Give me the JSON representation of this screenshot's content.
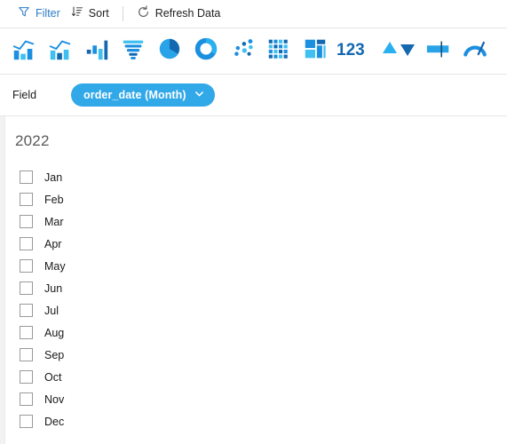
{
  "commandbar": {
    "items": [
      {
        "id": "filter",
        "label": "Filter",
        "icon": "funnel-icon",
        "style": "accent"
      },
      {
        "id": "sort",
        "label": "Sort",
        "icon": "sort-icon",
        "style": "dark"
      },
      {
        "id": "refresh",
        "label": "Refresh Data",
        "icon": "refresh-icon",
        "style": "dark"
      }
    ]
  },
  "viz_toolbar": {
    "items": [
      {
        "id": "line-column-combo",
        "icon": "line-column-chart-icon"
      },
      {
        "id": "line-column-combo2",
        "icon": "line-column-chart-alt-icon"
      },
      {
        "id": "column-chart",
        "icon": "column-chart-icon"
      },
      {
        "id": "funnel-chart",
        "icon": "funnel-chart-icon"
      },
      {
        "id": "pie-chart",
        "icon": "pie-chart-icon"
      },
      {
        "id": "donut-chart",
        "icon": "donut-chart-icon"
      },
      {
        "id": "scatter-chart",
        "icon": "scatter-chart-icon"
      },
      {
        "id": "heatmap-chart",
        "icon": "heatmap-grid-icon"
      },
      {
        "id": "treemap-chart",
        "icon": "treemap-icon"
      },
      {
        "id": "number-card",
        "icon": "number-123-icon"
      },
      {
        "id": "kpi-comparison",
        "icon": "up-down-triangles-icon"
      },
      {
        "id": "bullet-chart",
        "icon": "bullet-bar-icon"
      },
      {
        "id": "gauge-chart",
        "icon": "gauge-icon"
      }
    ]
  },
  "field_row": {
    "label": "Field",
    "selected_field": "order_date (Month)",
    "chevron": "chevron-down-icon",
    "pill_color": "#31a8e8"
  },
  "filter_list": {
    "group_title": "2022",
    "options": [
      {
        "label": "Jan",
        "checked": false
      },
      {
        "label": "Feb",
        "checked": false
      },
      {
        "label": "Mar",
        "checked": false
      },
      {
        "label": "Apr",
        "checked": false
      },
      {
        "label": "May",
        "checked": false
      },
      {
        "label": "Jun",
        "checked": false
      },
      {
        "label": "Jul",
        "checked": false
      },
      {
        "label": "Aug",
        "checked": false
      },
      {
        "label": "Sep",
        "checked": false
      },
      {
        "label": "Oct",
        "checked": false
      },
      {
        "label": "Nov",
        "checked": false
      },
      {
        "label": "Dec",
        "checked": false
      }
    ]
  },
  "colors": {
    "accent_text": "#2c7cc4",
    "icon_blue_dark": "#1468b0",
    "icon_blue": "#1b8fe0",
    "icon_blue_light": "#3fc0f0"
  }
}
